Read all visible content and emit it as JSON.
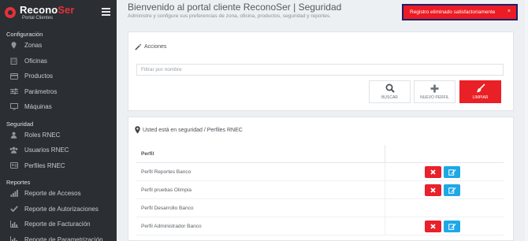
{
  "brand": {
    "name_part1": "Recono",
    "name_part2": "Ser",
    "subtitle": "Portal Clientes"
  },
  "sidebar": {
    "sections": [
      {
        "label": "Configuración",
        "items": [
          {
            "label": "Zonas",
            "icon": "map-pin-icon"
          },
          {
            "label": "Oficinas",
            "icon": "building-icon"
          },
          {
            "label": "Productos",
            "icon": "card-icon"
          },
          {
            "label": "Parámetros",
            "icon": "sliders-icon"
          },
          {
            "label": "Máquinas",
            "icon": "monitor-icon"
          }
        ]
      },
      {
        "label": "Seguridad",
        "items": [
          {
            "label": "Roles RNEC",
            "icon": "user-icon"
          },
          {
            "label": "Usuarios RNEC",
            "icon": "users-icon"
          },
          {
            "label": "Perfiles RNEC",
            "icon": "id-card-icon"
          }
        ]
      },
      {
        "label": "Reportes",
        "items": [
          {
            "label": "Reporte de Accesos",
            "icon": "signal-icon"
          },
          {
            "label": "Reporte de Autorizaciones",
            "icon": "check-icon"
          },
          {
            "label": "Reporte de Facturación",
            "icon": "bar-chart-icon"
          },
          {
            "label": "Reporte de Parametrización",
            "icon": "bar-chart-icon"
          }
        ]
      }
    ]
  },
  "header": {
    "title": "Bienvenido al portal cliente ReconoSer | Seguridad",
    "subtitle": "Administre y configure sus preferencias de zona, oficina, productos, seguridad y reportes."
  },
  "toast": {
    "message": "Registro eliminado satisfactoriamente",
    "close": "×",
    "color": "#ec1c24"
  },
  "actions_card": {
    "title": "Acciones",
    "filter_placeholder": "Filtrar por nombre",
    "buttons": {
      "search": "BUSCAR",
      "new": "NUEVO PERFIL",
      "clear": "LIMPIAR"
    }
  },
  "profiles_card": {
    "title": "Usted está en seguridad / Perfiles RNEC",
    "column_header": "Perfil",
    "rows": [
      {
        "name": "Perfil Reportes Banco",
        "has_actions": true
      },
      {
        "name": "Perfil pruebas Olimpia",
        "has_actions": true
      },
      {
        "name": "Perfil Desarrollo Banco",
        "has_actions": false
      },
      {
        "name": "Perfil Administrador Banco",
        "has_actions": true
      }
    ]
  }
}
